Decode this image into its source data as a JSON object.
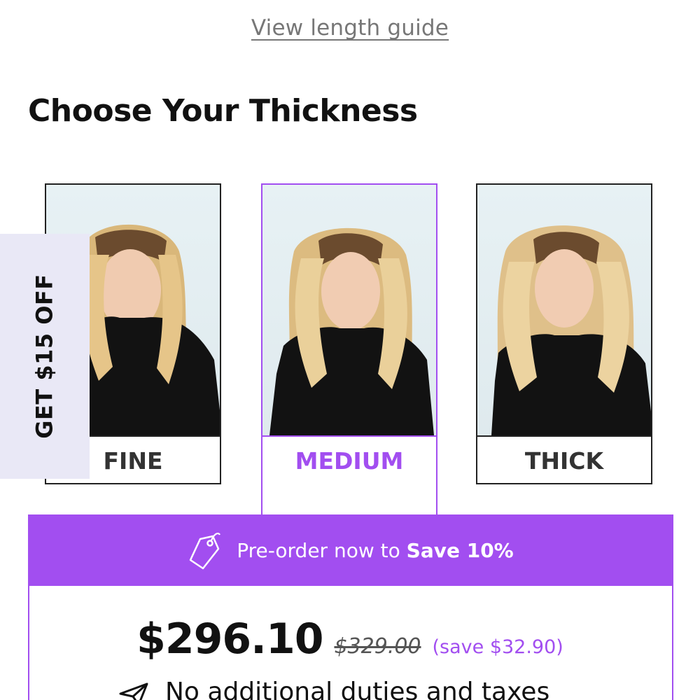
{
  "length_guide_link": "View length guide",
  "section_title": "Choose Your Thickness",
  "thickness_options": [
    {
      "label": "FINE",
      "selected": false
    },
    {
      "label": "MEDIUM",
      "selected": true
    },
    {
      "label": "THICK",
      "selected": false
    }
  ],
  "promo_tab": "GET $15 OFF",
  "preorder": {
    "text": "Pre-order now to ",
    "bold": "Save 10%"
  },
  "price": {
    "current": "$296.10",
    "original": "$329.00",
    "savings": "(save $32.90)"
  },
  "duties_text": "No additional duties and taxes",
  "colors": {
    "accent": "#a24ef0",
    "promo_tab_bg": "#e9e8f6",
    "photo_bg": "#e4eef2"
  }
}
